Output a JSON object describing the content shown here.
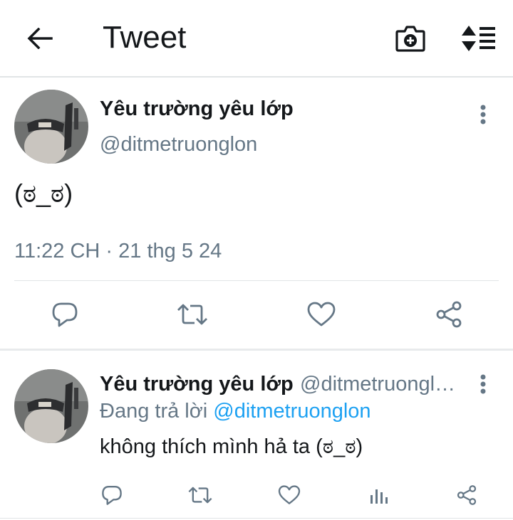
{
  "header": {
    "title": "Tweet",
    "back_icon": "back-arrow-icon",
    "camera_icon": "camera-plus-icon",
    "sort_icon": "sort-list-icon"
  },
  "main_tweet": {
    "display_name": "Yêu trường yêu lớp",
    "handle": "@ditmetruonglon",
    "text": "(ಠ_ಠ)",
    "timestamp": "11:22 CH · 21 thg 5 24",
    "actions": [
      "reply-icon",
      "retweet-icon",
      "like-icon",
      "share-icon"
    ]
  },
  "reply_tweet": {
    "display_name": "Yêu trường yêu lớp",
    "handle": "@ditmetruongl…",
    "replying_to_label": "Đang trả lời",
    "replying_to_handle": "@ditmetruonglon",
    "text": "không thích mình hả ta (ಠ_ಠ)",
    "actions": [
      "reply-icon",
      "retweet-icon",
      "like-icon",
      "analytics-icon",
      "share-icon"
    ]
  },
  "colors": {
    "text": "#14171a",
    "secondary": "#657786",
    "link": "#1da1f2",
    "divider": "#e1e4e6"
  }
}
